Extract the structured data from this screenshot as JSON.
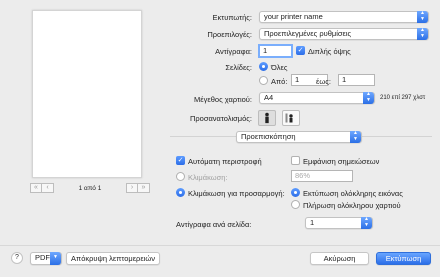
{
  "preview": {
    "page_indicator": "1 από 1",
    "nav": {
      "first": "«",
      "prev": "‹",
      "next": "›",
      "last": "»"
    }
  },
  "printer": {
    "label": "Εκτυπωτής:",
    "value": "your printer name"
  },
  "presets": {
    "label": "Προεπιλογές:",
    "value": "Προεπιλεγμένες ρυθμίσεις"
  },
  "copies": {
    "label": "Αντίγραφα:",
    "value": "1",
    "duplex_label": "Διπλής όψης"
  },
  "pages": {
    "label": "Σελίδες:",
    "all_label": "Όλες",
    "from_label": "Από:",
    "from_value": "1",
    "to_label": "έως:",
    "to_value": "1"
  },
  "paper": {
    "label": "Μέγεθος χαρτιού:",
    "value": "A4",
    "dimensions": "210 επί 297 χλστ"
  },
  "orientation": {
    "label": "Προσανατολισμός:"
  },
  "section": {
    "value": "Προεπισκόπηση"
  },
  "options": {
    "auto_rotate": "Αυτόματη περιστροφή",
    "show_notes": "Εμφάνιση σημειώσεων",
    "scale_label": "Κλιμάκωση:",
    "scale_value": "86%",
    "scale_to_fit_label": "Κλιμάκωση για προσαρμογή:",
    "print_entire": "Εκτύπωση ολόκληρης εικόνας",
    "fill_paper": "Πλήρωση ολόκληρου χαρτιού"
  },
  "copies_per_page": {
    "label": "Αντίγραφα ανά σελίδα:",
    "value": "1"
  },
  "bottom": {
    "help": "?",
    "pdf": "PDF",
    "hide_details": "Απόκρυψη λεπτομερειών",
    "cancel": "Ακύρωση",
    "print": "Εκτύπωση"
  },
  "colors": {
    "accent": "#2c6fe8",
    "window_bg": "#ececec"
  }
}
